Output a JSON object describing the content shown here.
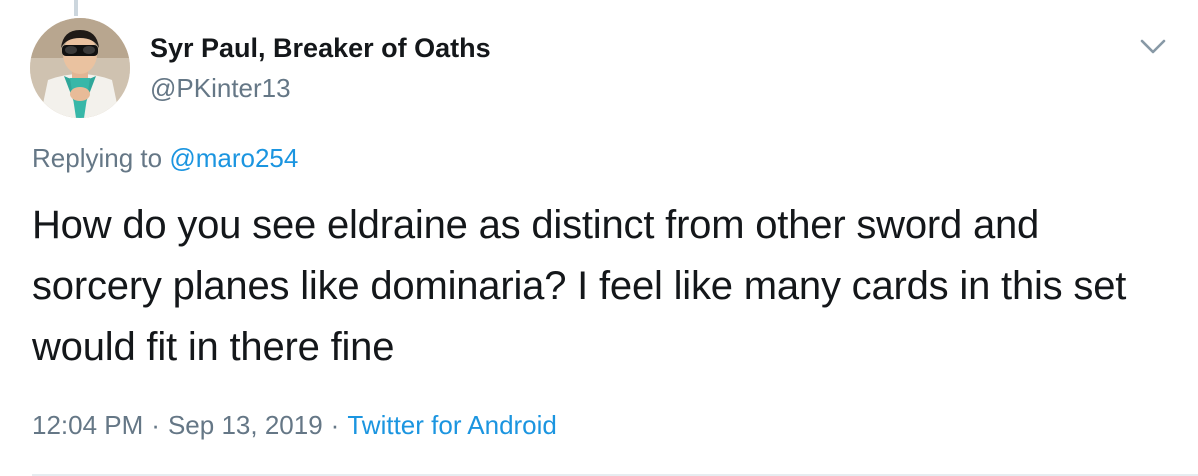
{
  "author": {
    "display_name": "Syr Paul, Breaker of Oaths",
    "handle": "@PKinter13"
  },
  "reply": {
    "prefix": "Replying to",
    "mention": "@maro254"
  },
  "tweet": {
    "text": "How do you see eldraine as distinct from other sword and sorcery planes like dominaria? I feel like many cards in this set would fit in there fine"
  },
  "meta": {
    "time": "12:04 PM",
    "separator": "·",
    "date": "Sep 13, 2019",
    "source": "Twitter for Android"
  },
  "icons": {
    "menu": "chevron-down-icon"
  },
  "colors": {
    "link": "#1b95e0",
    "secondary": "#657786",
    "text": "#14171a"
  }
}
